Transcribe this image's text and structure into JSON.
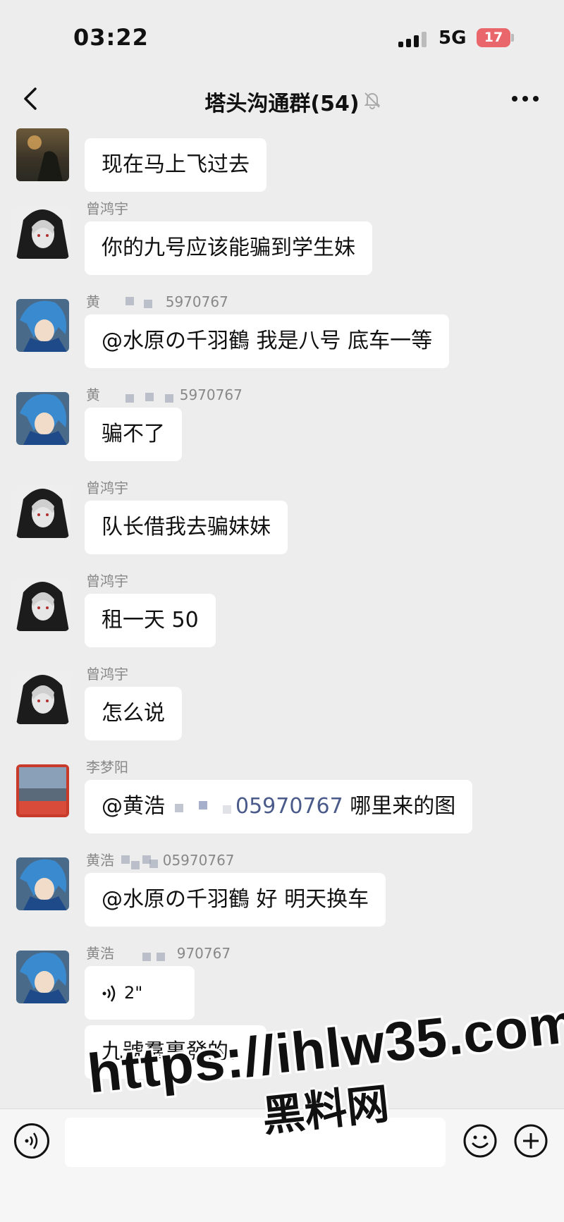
{
  "status_bar": {
    "time": "03:22",
    "network": "5G",
    "battery": "17"
  },
  "header": {
    "title": "塔头沟通群(54)"
  },
  "messages": [
    {
      "sender": "",
      "text": "现在马上飞过去"
    },
    {
      "sender": "曾鸿宇",
      "text": "你的九号应该能骗到学生妹"
    },
    {
      "sender_prefix": "黄",
      "sender_suffix": "5970767",
      "text": "@水原の千羽鶴 我是八号 底车一等"
    },
    {
      "sender_prefix": "黄",
      "sender_suffix": "5970767",
      "text": "骗不了"
    },
    {
      "sender": "曾鸿宇",
      "text": "队长借我去骗妹妹"
    },
    {
      "sender": "曾鸿宇",
      "text": "租一天 50"
    },
    {
      "sender": "曾鸿宇",
      "text": "怎么说"
    },
    {
      "sender": "李梦阳",
      "text_prefix": "@黄浩",
      "text_link": "05970767",
      "text_suffix": " 哪里来的图"
    },
    {
      "sender_prefix": "黄浩",
      "sender_suffix": "05970767",
      "text": "@水原の千羽鶴 好 明天换车"
    },
    {
      "sender_prefix": "黄浩",
      "sender_suffix": "970767",
      "voice_duration": "2\"",
      "text": "九號羣裏發的。"
    }
  ],
  "watermark": {
    "url": "https://ihlw35.com",
    "name": "黑料网"
  },
  "colors": {
    "background": "#ededed",
    "bubble": "#ffffff",
    "battery": "#e9666a",
    "mention": "#4a5a8a"
  }
}
